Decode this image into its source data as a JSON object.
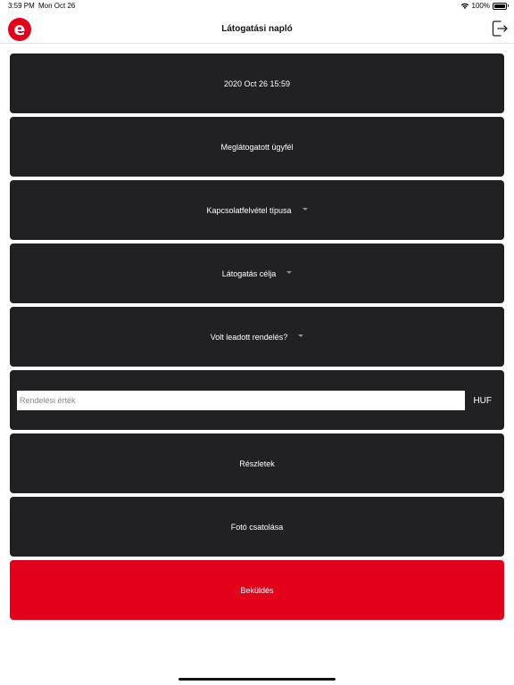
{
  "status_bar": {
    "time": "3:59 PM",
    "date": "Mon Oct 26",
    "battery": "100%",
    "icons": [
      "wifi-icon",
      "battery-icon"
    ]
  },
  "nav": {
    "title": "Látogatási napló",
    "logo_letter": "e",
    "logout_icon": "logout-icon"
  },
  "form": {
    "datetime": "2020 Oct 26 15:59",
    "client": "Meglátogatott ügyfél",
    "contact_type": "Kapcsolatfelvétel típusa",
    "visit_purpose": "Látogatás célja",
    "order_placed": "Volt leadott rendelés?",
    "order_value_placeholder": "Rendelési érték",
    "order_value": "",
    "currency": "HUF",
    "details": "Részletek",
    "attach_photo": "Fotó csatolása",
    "submit": "Beküldés"
  },
  "colors": {
    "tile_bg": "#212124",
    "brand_red": "#e2001a",
    "page_bg": "#ffffff"
  }
}
